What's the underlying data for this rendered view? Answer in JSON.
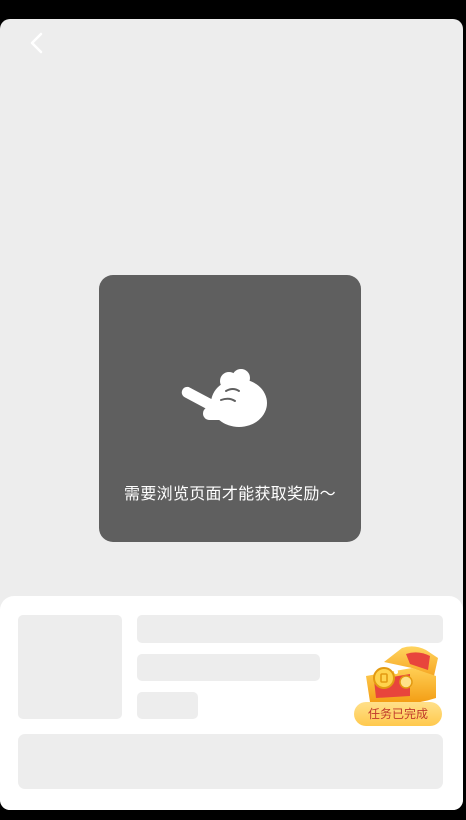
{
  "nav": {
    "back_icon": "chevron-left-icon"
  },
  "hint": {
    "icon": "pointing-hand-icon",
    "text": "需要浏览页面才能获取奖励～"
  },
  "reward": {
    "icon": "treasure-chest-icon",
    "status_label": "任务已完成"
  },
  "colors": {
    "background": "#ededed",
    "hint_card": "#5f5f5f",
    "placeholder": "#ededed",
    "pill_start": "#ffe08a",
    "pill_end": "#ffc94d",
    "pill_text": "#c0392b"
  }
}
